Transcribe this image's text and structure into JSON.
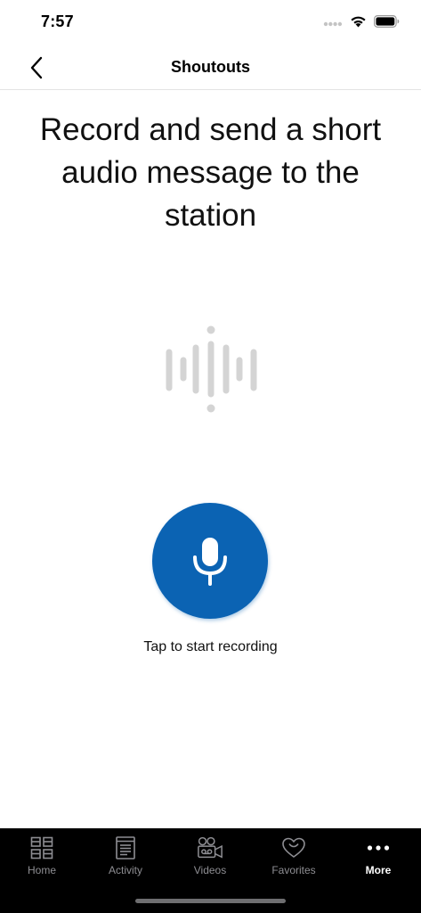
{
  "status_bar": {
    "time": "7:57"
  },
  "nav": {
    "title": "Shoutouts"
  },
  "main": {
    "headline": "Record and send a short audio message to the station",
    "record_hint": "Tap to start recording",
    "waveform_icon": "waveform-icon",
    "mic_icon": "microphone-icon"
  },
  "tab_bar": {
    "items": [
      {
        "label": "Home",
        "icon": "grid-icon"
      },
      {
        "label": "Activity",
        "icon": "list-icon"
      },
      {
        "label": "Videos",
        "icon": "video-camera-icon"
      },
      {
        "label": "Favorites",
        "icon": "heart-icon"
      },
      {
        "label": "More",
        "icon": "more-icon"
      }
    ],
    "active": "More"
  },
  "colors": {
    "accent": "#0b63b3",
    "tab_bar_bg": "#000000",
    "tab_inactive": "#8e8e93",
    "waveform": "#d4d4d4"
  }
}
